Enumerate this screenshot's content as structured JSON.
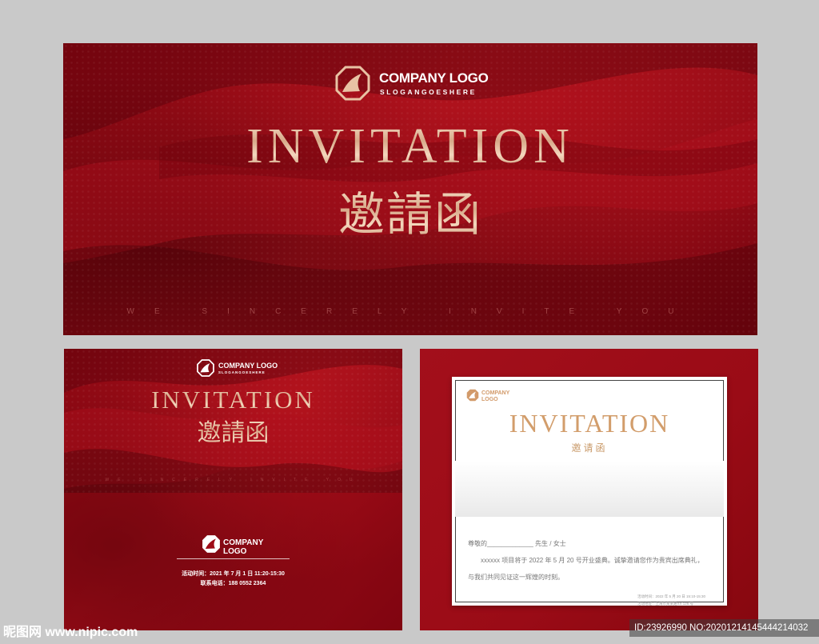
{
  "colors": {
    "background": "#c9c9c9",
    "card_red": "#9e0c18",
    "gold": "#d7a989",
    "card_text": "#777777"
  },
  "top_card": {
    "company": "COMPANY LOGO",
    "slogan": "SLOGANGOESHERE",
    "title": "INVITATION",
    "title_cn": "邀請函",
    "tagline": "WE SINCERELY INVITE YOU"
  },
  "front_card": {
    "company": "COMPANY LOGO",
    "slogan": "SLOGANGOESHERE",
    "title": "INVITATION",
    "title_cn": "邀請函",
    "tagline": "WE SINCERELY INVITE YOU",
    "logo_company": "COMPANY",
    "logo_word": "LOGO",
    "event_time": "活动时间：2021 年 7 月 1 日 11:20-15:30",
    "contact": "联系电话：188 0552 2364"
  },
  "inner_card": {
    "logo_company": "COMPANY",
    "logo_word": "LOGO",
    "title": "INVITATION",
    "title_cn": "邀请函",
    "salutation": "尊敬的_____________ 先生 / 女士",
    "paragraph_1": "xxxxxx 项目将于 2022 年 5 月 20 号开业盛典。诚挚邀请您作为贵宾出席典礼，",
    "paragraph_2": "与我们共同见证这一辉煌的时刻。",
    "footer_time": "活动时间：2022 年 5 月 20 日 15:10-15:30",
    "footer_place": "活动地址：上海市某某路XX 126 号"
  },
  "watermark": {
    "site": "昵图网 www.nipic.com",
    "id_text": "ID:23926990 NO:20201214145444214032"
  },
  "icons": {
    "company_logo_mark": "octagon-badge-icon"
  }
}
